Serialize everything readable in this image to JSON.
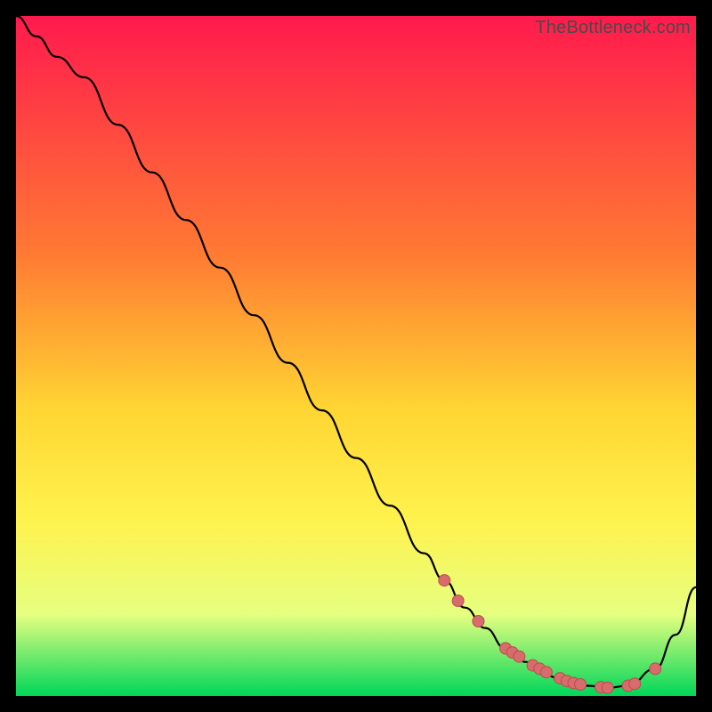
{
  "watermark": "TheBottleneck.com",
  "colors": {
    "bg": "#000000",
    "grad_top": "#ff1a4d",
    "grad_mid1": "#ff7a33",
    "grad_mid2": "#ffd633",
    "grad_mid3": "#fff24d",
    "grad_mid4": "#e6ff80",
    "grad_bottom": "#00d659",
    "curve": "#000000",
    "marker_fill": "#d86b6b",
    "marker_stroke": "#b74e4e"
  },
  "chart_data": {
    "type": "line",
    "title": "",
    "xlabel": "",
    "ylabel": "",
    "xlim": [
      0,
      100
    ],
    "ylim": [
      0,
      100
    ],
    "series": [
      {
        "name": "bottleneck-curve",
        "x": [
          0,
          3,
          6,
          10,
          15,
          20,
          25,
          30,
          35,
          40,
          45,
          50,
          55,
          60,
          63,
          66,
          69,
          72,
          75,
          78,
          81,
          84,
          87,
          90,
          94,
          97,
          100
        ],
        "y": [
          100,
          97,
          94,
          91,
          84,
          77,
          70,
          63,
          56,
          49,
          42,
          35,
          28,
          21,
          17,
          13,
          10,
          7,
          5,
          3,
          2,
          1.5,
          1.2,
          1.5,
          4,
          9,
          16
        ]
      }
    ],
    "markers": {
      "name": "highlight-points",
      "x": [
        63,
        65,
        68,
        72,
        73,
        74,
        76,
        77,
        78,
        80,
        81,
        82,
        83,
        86,
        87,
        90,
        91,
        94
      ],
      "y": [
        17,
        14,
        11,
        7,
        6.4,
        5.8,
        4.5,
        4.0,
        3.5,
        2.6,
        2.2,
        1.9,
        1.7,
        1.3,
        1.2,
        1.5,
        1.8,
        4.0
      ]
    }
  }
}
